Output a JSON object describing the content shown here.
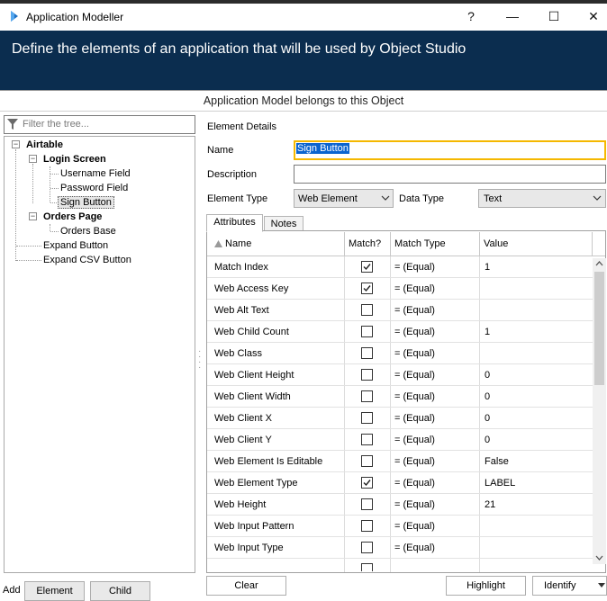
{
  "window": {
    "title": "Application Modeller",
    "help_glyph": "?",
    "min_glyph": "—",
    "max_glyph": "☐",
    "close_glyph": "✕"
  },
  "banner": {
    "text": "Define the elements of an application that will be used by Object Studio"
  },
  "caption": {
    "text": "Application Model belongs to this Object"
  },
  "tree": {
    "filter_placeholder": "Filter the tree...",
    "items": [
      {
        "label": "Airtable",
        "bold": true
      },
      {
        "label": "Login Screen",
        "bold": true
      },
      {
        "label": "Username Field"
      },
      {
        "label": "Password Field"
      },
      {
        "label": "Sign Button",
        "selected": true
      },
      {
        "label": "Orders Page",
        "bold": true
      },
      {
        "label": "Orders Base"
      },
      {
        "label": "Expand Button"
      },
      {
        "label": "Expand CSV Button"
      }
    ],
    "expander_glyph": "−"
  },
  "details": {
    "heading": "Element Details",
    "name_label": "Name",
    "name_value": "Sign Button",
    "description_label": "Description",
    "description_value": "",
    "element_type_label": "Element Type",
    "element_type_value": "Web Element",
    "data_type_label": "Data Type",
    "data_type_value": "Text"
  },
  "tabs": [
    {
      "label": "Attributes",
      "active": true
    },
    {
      "label": "Notes"
    }
  ],
  "grid": {
    "columns": {
      "name": "Name",
      "sort_glyph": "▲",
      "match": "Match?",
      "match_type": "Match Type",
      "value": "Value"
    },
    "rows": [
      {
        "name": "Match Index",
        "checked": true,
        "match_type": "=  (Equal)",
        "value": "1"
      },
      {
        "name": "Web Access Key",
        "checked": true,
        "match_type": "=  (Equal)",
        "value": ""
      },
      {
        "name": "Web Alt Text",
        "checked": false,
        "match_type": "=  (Equal)",
        "value": ""
      },
      {
        "name": "Web Child Count",
        "checked": false,
        "match_type": "=  (Equal)",
        "value": "1"
      },
      {
        "name": "Web Class",
        "checked": false,
        "match_type": "=  (Equal)",
        "value": ""
      },
      {
        "name": "Web Client Height",
        "checked": false,
        "match_type": "=  (Equal)",
        "value": "0"
      },
      {
        "name": "Web Client Width",
        "checked": false,
        "match_type": "=  (Equal)",
        "value": "0"
      },
      {
        "name": "Web Client X",
        "checked": false,
        "match_type": "=  (Equal)",
        "value": "0"
      },
      {
        "name": "Web Client Y",
        "checked": false,
        "match_type": "=  (Equal)",
        "value": "0"
      },
      {
        "name": "Web Element Is Editable",
        "checked": false,
        "match_type": "=  (Equal)",
        "value": "False"
      },
      {
        "name": "Web Element Type",
        "checked": true,
        "match_type": "=  (Equal)",
        "value": "LABEL"
      },
      {
        "name": "Web Height",
        "checked": false,
        "match_type": "=  (Equal)",
        "value": "21"
      },
      {
        "name": "Web Input Pattern",
        "checked": false,
        "match_type": "=  (Equal)",
        "value": ""
      },
      {
        "name": "Web Input Type",
        "checked": false,
        "match_type": "=  (Equal)",
        "value": ""
      }
    ]
  },
  "bottom": {
    "add_label": "Add",
    "element_button": "Element",
    "child_button": "Child",
    "clear_button": "Clear",
    "highlight_button": "Highlight",
    "identify_button": "Identify"
  },
  "colors": {
    "banner": "#0b2d4f",
    "selection": "#0a64d0",
    "focus_border": "#f5b800"
  }
}
